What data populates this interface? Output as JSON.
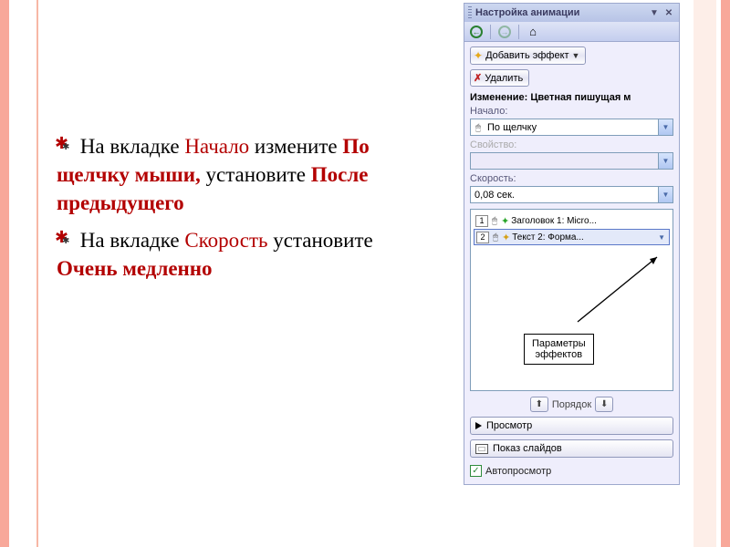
{
  "instructions": {
    "item1": {
      "t1": "На вкладке ",
      "k1": "Начало",
      "t2": " измените ",
      "k2": "По щелчку мыши,",
      "t3": " установите ",
      "k3": "После предыдущего"
    },
    "item2": {
      "t1": "На вкладке ",
      "k1": "Скорость",
      "t2": " установите ",
      "k2": "Очень медленно"
    }
  },
  "panel": {
    "title": "Настройка анимации",
    "buttons": {
      "add_effect": "Добавить эффект",
      "remove": "Удалить"
    },
    "change_label": "Изменение: Цветная пишущая м",
    "fields": {
      "start_label": "Начало:",
      "start_value": "По щелчку",
      "property_label": "Свойство:",
      "property_value": "",
      "speed_label": "Скорость:",
      "speed_value": "0,08 сек."
    },
    "effects": {
      "e1": {
        "num": "1",
        "label": "Заголовок 1: Micro..."
      },
      "e2": {
        "num": "2",
        "label": "Текст 2: Форма..."
      }
    },
    "callout": {
      "l1": "Параметры",
      "l2": "эффектов"
    },
    "reorder_label": "Порядок",
    "preview": "Просмотр",
    "slideshow": "Показ слайдов",
    "autopreview": "Автопросмотр"
  }
}
